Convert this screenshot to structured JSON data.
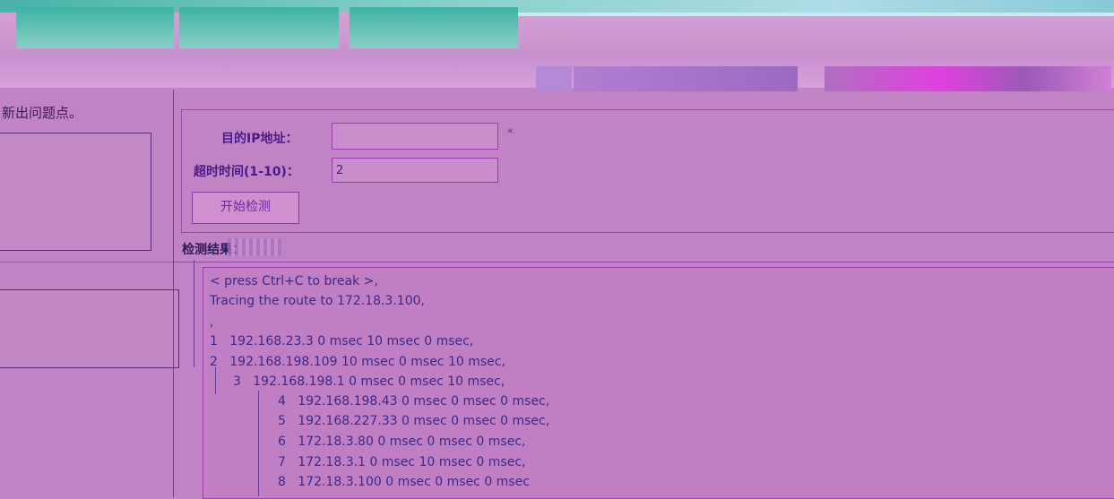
{
  "header": {
    "tabs": [
      "",
      "",
      ""
    ],
    "subtitle": ""
  },
  "left": {
    "text": "新出问题点。"
  },
  "form": {
    "ip_label": "目的IP地址：",
    "ip_value": "",
    "required_mark": "*",
    "timeout_label": "超时时间(1-10)：",
    "timeout_value": "2",
    "start_button": "开始检测"
  },
  "result": {
    "label": "检测结果：",
    "lines": [
      "< press Ctrl+C to break >,",
      "Tracing the route to 172.18.3.100,",
      ",",
      "1   192.168.23.3 0 msec 10 msec 0 msec,",
      "2   192.168.198.109 10 msec 0 msec 10 msec,",
      "3   192.168.198.1 0 msec 0 msec 10 msec,",
      "4   192.168.198.43 0 msec 0 msec 0 msec,",
      "5   192.168.227.33 0 msec 0 msec 0 msec,",
      "6   172.18.3.80 0 msec 0 msec 0 msec,",
      "7   172.18.3.1 0 msec 10 msec 0 msec,",
      "8   172.18.3.100 0 msec 0 msec 0 msec"
    ]
  }
}
